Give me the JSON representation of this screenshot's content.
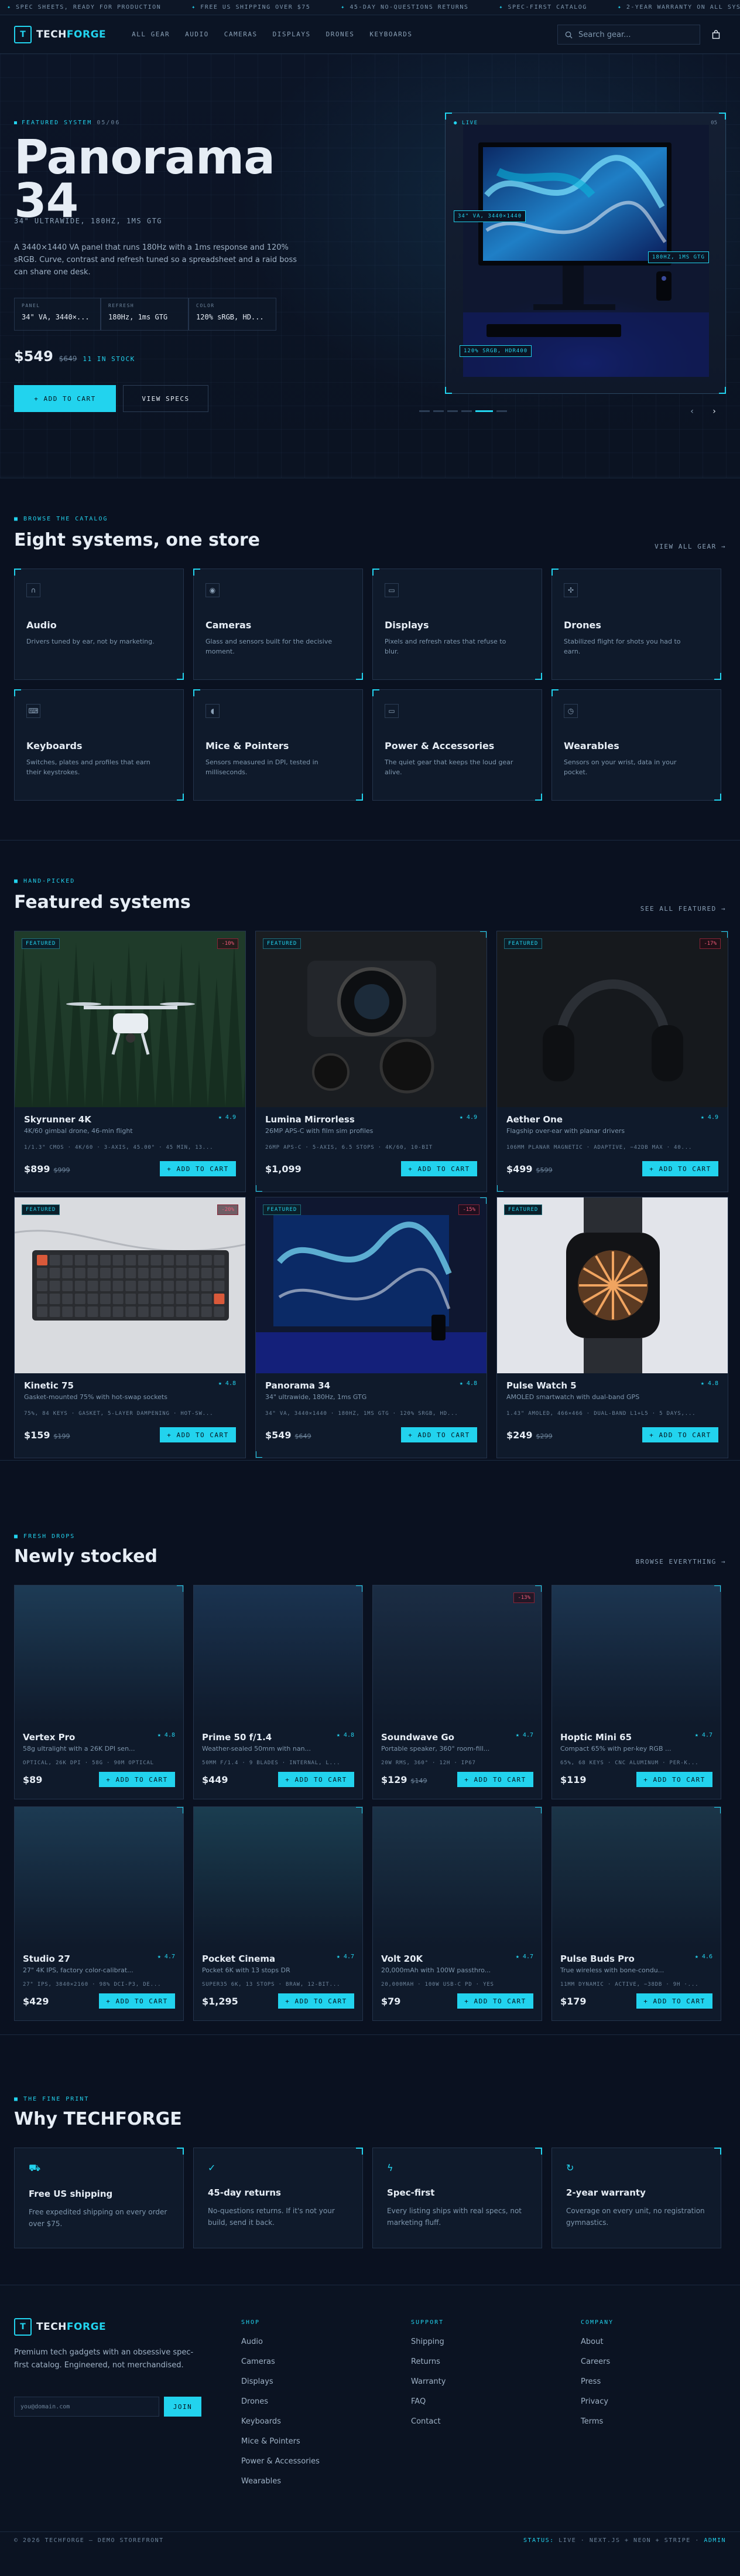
{
  "ticker": [
    "SPEC SHEETS, READY FOR PRODUCTION",
    "FREE US SHIPPING OVER $75",
    "45-DAY NO-QUESTIONS RETURNS",
    "SPEC-FIRST CATALOG",
    "2-YEAR WARRANTY ON ALL SYSTEMS"
  ],
  "nav": {
    "logo_mark": "T",
    "logo_a": "TECH",
    "logo_b": "FORGE",
    "links": [
      "ALL GEAR",
      "AUDIO",
      "CAMERAS",
      "DISPLAYS",
      "DRONES",
      "KEYBOARDS"
    ],
    "search_placeholder": "Search gear..."
  },
  "hero": {
    "eyebrow": "FEATURED SYSTEM",
    "counter": "05/06",
    "title_line1": "Panorama",
    "title_line2": "34",
    "subtitle": "34\" ULTRAWIDE, 180HZ, 1MS GTG",
    "description": "A 3440×1440 VA panel that runs 180Hz with a 1ms response and 120% sRGB. Curve, contrast and refresh tuned so a spreadsheet and a raid boss can share one desk.",
    "specs": [
      {
        "k": "PANEL",
        "v": "34\" VA, 3440×..."
      },
      {
        "k": "REFRESH",
        "v": "180Hz, 1ms GTG"
      },
      {
        "k": "COLOR",
        "v": "120% sRGB, HD..."
      }
    ],
    "price": "$549",
    "old_price": "$649",
    "stock": "11 IN STOCK",
    "add_label": "+ ADD TO CART",
    "view_label": "VIEW SPECS",
    "live_label": "LIVE",
    "frame_counter": "05",
    "callouts": [
      "34\" VA, 3440×1440",
      "180HZ, 1MS GTG",
      "120% SRGB, HDR400"
    ],
    "slide_count": 6,
    "active_slide": 5
  },
  "catalog": {
    "eyebrow": "BROWSE THE CATALOG",
    "title": "Eight systems, one store",
    "link": "VIEW ALL GEAR →",
    "items": [
      {
        "title": "Audio",
        "desc": "Drivers tuned by ear, not by marketing.",
        "icon": "headphones-icon"
      },
      {
        "title": "Cameras",
        "desc": "Glass and sensors built for the decisive moment.",
        "icon": "camera-icon"
      },
      {
        "title": "Displays",
        "desc": "Pixels and refresh rates that refuse to blur.",
        "icon": "monitor-icon"
      },
      {
        "title": "Drones",
        "desc": "Stabilized flight for shots you had to earn.",
        "icon": "drone-icon"
      },
      {
        "title": "Keyboards",
        "desc": "Switches, plates and profiles that earn their keystrokes.",
        "icon": "keyboard-icon"
      },
      {
        "title": "Mice & Pointers",
        "desc": "Sensors measured in DPI, tested in milliseconds.",
        "icon": "mouse-icon"
      },
      {
        "title": "Power & Accessories",
        "desc": "The quiet gear that keeps the loud gear alive.",
        "icon": "plug-icon"
      },
      {
        "title": "Wearables",
        "desc": "Sensors on your wrist, data in your pocket.",
        "icon": "watch-icon"
      }
    ]
  },
  "featured": {
    "eyebrow": "HAND-PICKED",
    "title": "Featured systems",
    "link": "SEE ALL FEATURED →",
    "badge": "FEATURED",
    "add_label": "+ ADD TO CART",
    "items": [
      {
        "name": "Skyrunner 4K",
        "rating": "★ 4.9",
        "desc": "4K/60 gimbal drone, 46-min flight",
        "spec": "1/1.3\" CMOS · 4K/60 · 3-AXIS, 45.00° · 45 MIN, 13...",
        "price": "$899",
        "old": "$999",
        "discount": "-10%",
        "img": "drone"
      },
      {
        "name": "Lumina Mirrorless",
        "rating": "★ 4.9",
        "desc": "26MP APS-C with film sim profiles",
        "spec": "26MP APS-C · 5-AXIS, 6.5 STOPS · 4K/60, 10-BIT",
        "price": "$1,099",
        "old": "",
        "discount": "",
        "img": "camera"
      },
      {
        "name": "Aether One",
        "rating": "★ 4.9",
        "desc": "Flagship over-ear with planar drivers",
        "spec": "106MM PLANAR MAGNETIC · ADAPTIVE, −42DB MAX · 40...",
        "price": "$499",
        "old": "$599",
        "discount": "-17%",
        "img": "headphones"
      },
      {
        "name": "Kinetic 75",
        "rating": "★ 4.8",
        "desc": "Gasket-mounted 75% with hot-swap sockets",
        "spec": "75%, 84 KEYS · GASKET, 5-LAYER DAMPENING · HOT-SW...",
        "price": "$159",
        "old": "$199",
        "discount": "-20%",
        "img": "keyboard"
      },
      {
        "name": "Panorama 34",
        "rating": "★ 4.8",
        "desc": "34\" ultrawide, 180Hz, 1ms GTG",
        "spec": "34\" VA, 3440×1440 · 180HZ, 1MS GTG · 120% SRGB, HD...",
        "price": "$549",
        "old": "$649",
        "discount": "-15%",
        "img": "monitor"
      },
      {
        "name": "Pulse Watch 5",
        "rating": "★ 4.8",
        "desc": "AMOLED smartwatch with dual-band GPS",
        "spec": "1.43\" AMOLED, 466×466 · DUAL-BAND L1+L5 · 5 DAYS,...",
        "price": "$249",
        "old": "$299",
        "discount": "",
        "img": "watch"
      }
    ]
  },
  "fresh": {
    "eyebrow": "FRESH DROPS",
    "title": "Newly stocked",
    "link": "BROWSE EVERYTHING →",
    "add_label": "+ ADD TO CART",
    "items": [
      {
        "name": "Vertex Pro",
        "rating": "★ 4.8",
        "desc": "58g ultralight with a 26K DPI sen...",
        "spec": "OPTICAL, 26K DPI · 58G · 90M OPTICAL",
        "price": "$89",
        "old": "",
        "discount": ""
      },
      {
        "name": "Prime 50 f/1.4",
        "rating": "★ 4.8",
        "desc": "Weather-sealed 50mm with nan...",
        "spec": "50MM F/1.4 · 9 BLADES · INTERNAL, L...",
        "price": "$449",
        "old": "",
        "discount": ""
      },
      {
        "name": "Soundwave Go",
        "rating": "★ 4.7",
        "desc": "Portable speaker, 360° room-fill...",
        "spec": "20W RMS, 360° · 12H · IP67",
        "price": "$129",
        "old": "$149",
        "discount": "-13%"
      },
      {
        "name": "Hoptic Mini 65",
        "rating": "★ 4.7",
        "desc": "Compact 65% with per-key RGB ...",
        "spec": "65%, 68 KEYS · CNC ALUMINUM · PER-K...",
        "price": "$119",
        "old": "",
        "discount": ""
      },
      {
        "name": "Studio 27",
        "rating": "★ 4.7",
        "desc": "27\" 4K IPS, factory color-calibrat...",
        "spec": "27\" IPS, 3840×2160 · 98% DCI-P3, DE...",
        "price": "$429",
        "old": "",
        "discount": ""
      },
      {
        "name": "Pocket Cinema",
        "rating": "★ 4.7",
        "desc": "Pocket 6K with 13 stops DR",
        "spec": "SUPER35 6K, 13 STOPS · BRAW, 12-BIT...",
        "price": "$1,295",
        "old": "",
        "discount": ""
      },
      {
        "name": "Volt 20K",
        "rating": "★ 4.7",
        "desc": "20,000mAh with 100W passthro...",
        "spec": "20,000MAH · 100W USB-C PD · YES",
        "price": "$79",
        "old": "",
        "discount": ""
      },
      {
        "name": "Pulse Buds Pro",
        "rating": "★ 4.6",
        "desc": "True wireless with bone-condu...",
        "spec": "11MM DYNAMIC · ACTIVE, −38DB · 9H ·...",
        "price": "$179",
        "old": "",
        "discount": ""
      }
    ]
  },
  "why": {
    "eyebrow": "THE FINE PRINT",
    "title": "Why TECHFORGE",
    "items": [
      {
        "title": "Free US shipping",
        "desc": "Free expedited shipping on every order over $75.",
        "icon": "truck-icon"
      },
      {
        "title": "45-day returns",
        "desc": "No-questions returns. If it's not your build, send it back.",
        "icon": "shield-check-icon"
      },
      {
        "title": "Spec-first",
        "desc": "Every listing ships with real specs, not marketing fluff.",
        "icon": "bolt-icon"
      },
      {
        "title": "2-year warranty",
        "desc": "Coverage on every unit, no registration gymnastics.",
        "icon": "refresh-icon"
      }
    ]
  },
  "footer": {
    "blurb": "Premium tech gadgets with an obsessive spec-first catalog. Engineered, not merchandised.",
    "email_placeholder": "you@domain.com",
    "join_label": "JOIN",
    "cols": [
      {
        "title": "SHOP",
        "links": [
          "Audio",
          "Cameras",
          "Displays",
          "Drones",
          "Keyboards",
          "Mice & Pointers",
          "Power & Accessories",
          "Wearables"
        ]
      },
      {
        "title": "SUPPORT",
        "links": [
          "Shipping",
          "Returns",
          "Warranty",
          "FAQ",
          "Contact"
        ]
      },
      {
        "title": "COMPANY",
        "links": [
          "About",
          "Careers",
          "Press",
          "Privacy",
          "Terms"
        ]
      }
    ],
    "copyright": "© 2026 TECHFORGE — DEMO STOREFRONT",
    "status_label": "STATUS:",
    "status_value": "LIVE · NEXT.JS + NEON + STRIPE ·",
    "admin_label": "ADMIN"
  },
  "colors": {
    "accent": "#22d3ee",
    "bg": "#0a1120",
    "danger": "#f05a78"
  }
}
